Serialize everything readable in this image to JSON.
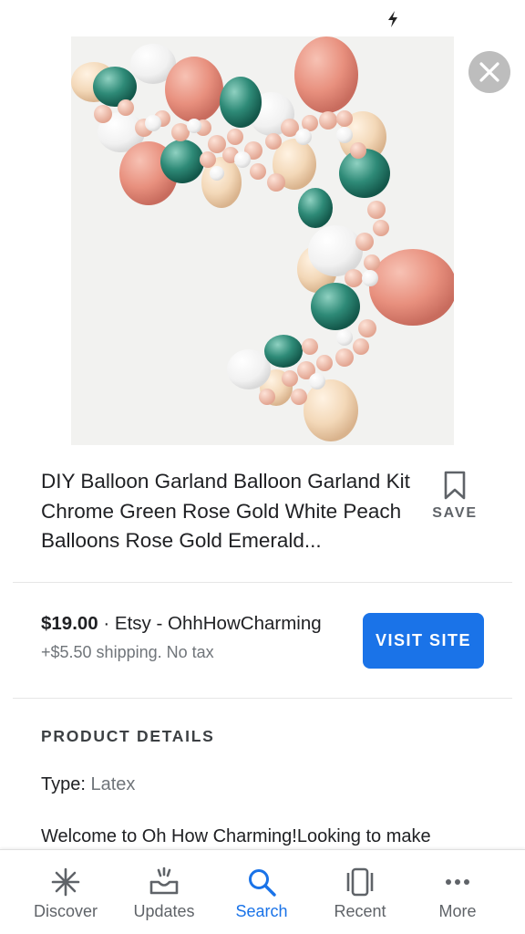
{
  "status_bar": {
    "flash_icon": "flash-icon"
  },
  "colors": {
    "accent": "#1a73e8",
    "text": "#202124",
    "secondary_text": "#70757a",
    "close_bg": "#bdbdbd"
  },
  "product": {
    "title": "DIY Balloon Garland Balloon Garland Kit Chrome Green Rose Gold White Peach Balloons Rose Gold Emerald...",
    "save_label": "SAVE",
    "price": "$19.00",
    "seller": " · Etsy - OhhHowCharming",
    "shipping": "+$5.50 shipping. No tax",
    "visit_label": "VISIT SITE"
  },
  "details": {
    "heading": "PRODUCT DETAILS",
    "type_label": "Type: ",
    "type_value": "Latex",
    "description": "Welcome to Oh How Charming!Looking to make"
  },
  "bottom_nav": {
    "items": [
      {
        "label": "Discover",
        "icon": "asterisk-icon"
      },
      {
        "label": "Updates",
        "icon": "updates-tray-icon"
      },
      {
        "label": "Search",
        "icon": "search-icon",
        "active": true
      },
      {
        "label": "Recent",
        "icon": "recent-cards-icon"
      },
      {
        "label": "More",
        "icon": "more-dots-icon"
      }
    ]
  }
}
